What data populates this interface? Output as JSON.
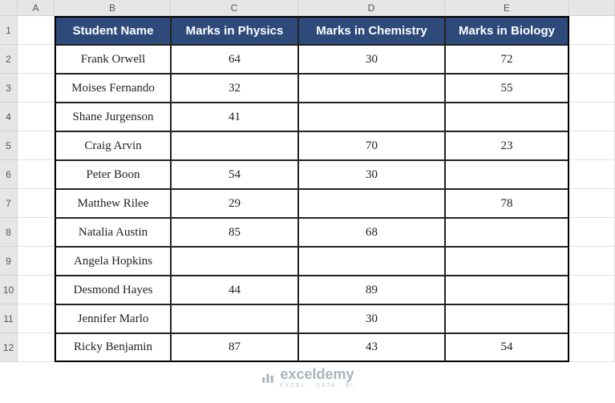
{
  "columns": [
    "A",
    "B",
    "C",
    "D",
    "E"
  ],
  "rows": [
    "1",
    "2",
    "3",
    "4",
    "5",
    "6",
    "7",
    "8",
    "9",
    "10",
    "11",
    "12"
  ],
  "headers": [
    "Student Name",
    "Marks in Physics",
    "Marks in Chemistry",
    "Marks in Biology"
  ],
  "data": [
    {
      "name": "Frank Orwell",
      "phy": "64",
      "chem": "30",
      "bio": "72"
    },
    {
      "name": "Moises Fernando",
      "phy": "32",
      "chem": "",
      "bio": "55"
    },
    {
      "name": "Shane Jurgenson",
      "phy": "41",
      "chem": "",
      "bio": ""
    },
    {
      "name": "Craig Arvin",
      "phy": "",
      "chem": "70",
      "bio": "23"
    },
    {
      "name": "Peter Boon",
      "phy": "54",
      "chem": "30",
      "bio": ""
    },
    {
      "name": "Matthew Rilee",
      "phy": "29",
      "chem": "",
      "bio": "78"
    },
    {
      "name": "Natalia Austin",
      "phy": "85",
      "chem": "68",
      "bio": ""
    },
    {
      "name": "Angela Hopkins",
      "phy": "",
      "chem": "",
      "bio": ""
    },
    {
      "name": "Desmond Hayes",
      "phy": "44",
      "chem": "89",
      "bio": ""
    },
    {
      "name": "Jennifer Marlo",
      "phy": "",
      "chem": "30",
      "bio": ""
    },
    {
      "name": "Ricky Benjamin",
      "phy": "87",
      "chem": "43",
      "bio": "54"
    }
  ],
  "watermark": {
    "brand": "exceldemy",
    "tag": "EXCEL · DATA · BI"
  },
  "chart_data": {
    "type": "table",
    "title": "",
    "columns": [
      "Student Name",
      "Marks in Physics",
      "Marks in Chemistry",
      "Marks in Biology"
    ],
    "rows": [
      [
        "Frank Orwell",
        64,
        30,
        72
      ],
      [
        "Moises Fernando",
        32,
        null,
        55
      ],
      [
        "Shane Jurgenson",
        41,
        null,
        null
      ],
      [
        "Craig Arvin",
        null,
        70,
        23
      ],
      [
        "Peter Boon",
        54,
        30,
        null
      ],
      [
        "Matthew Rilee",
        29,
        null,
        78
      ],
      [
        "Natalia Austin",
        85,
        68,
        null
      ],
      [
        "Angela Hopkins",
        null,
        null,
        null
      ],
      [
        "Desmond Hayes",
        44,
        89,
        null
      ],
      [
        "Jennifer Marlo",
        null,
        30,
        null
      ],
      [
        "Ricky Benjamin",
        87,
        43,
        54
      ]
    ]
  }
}
